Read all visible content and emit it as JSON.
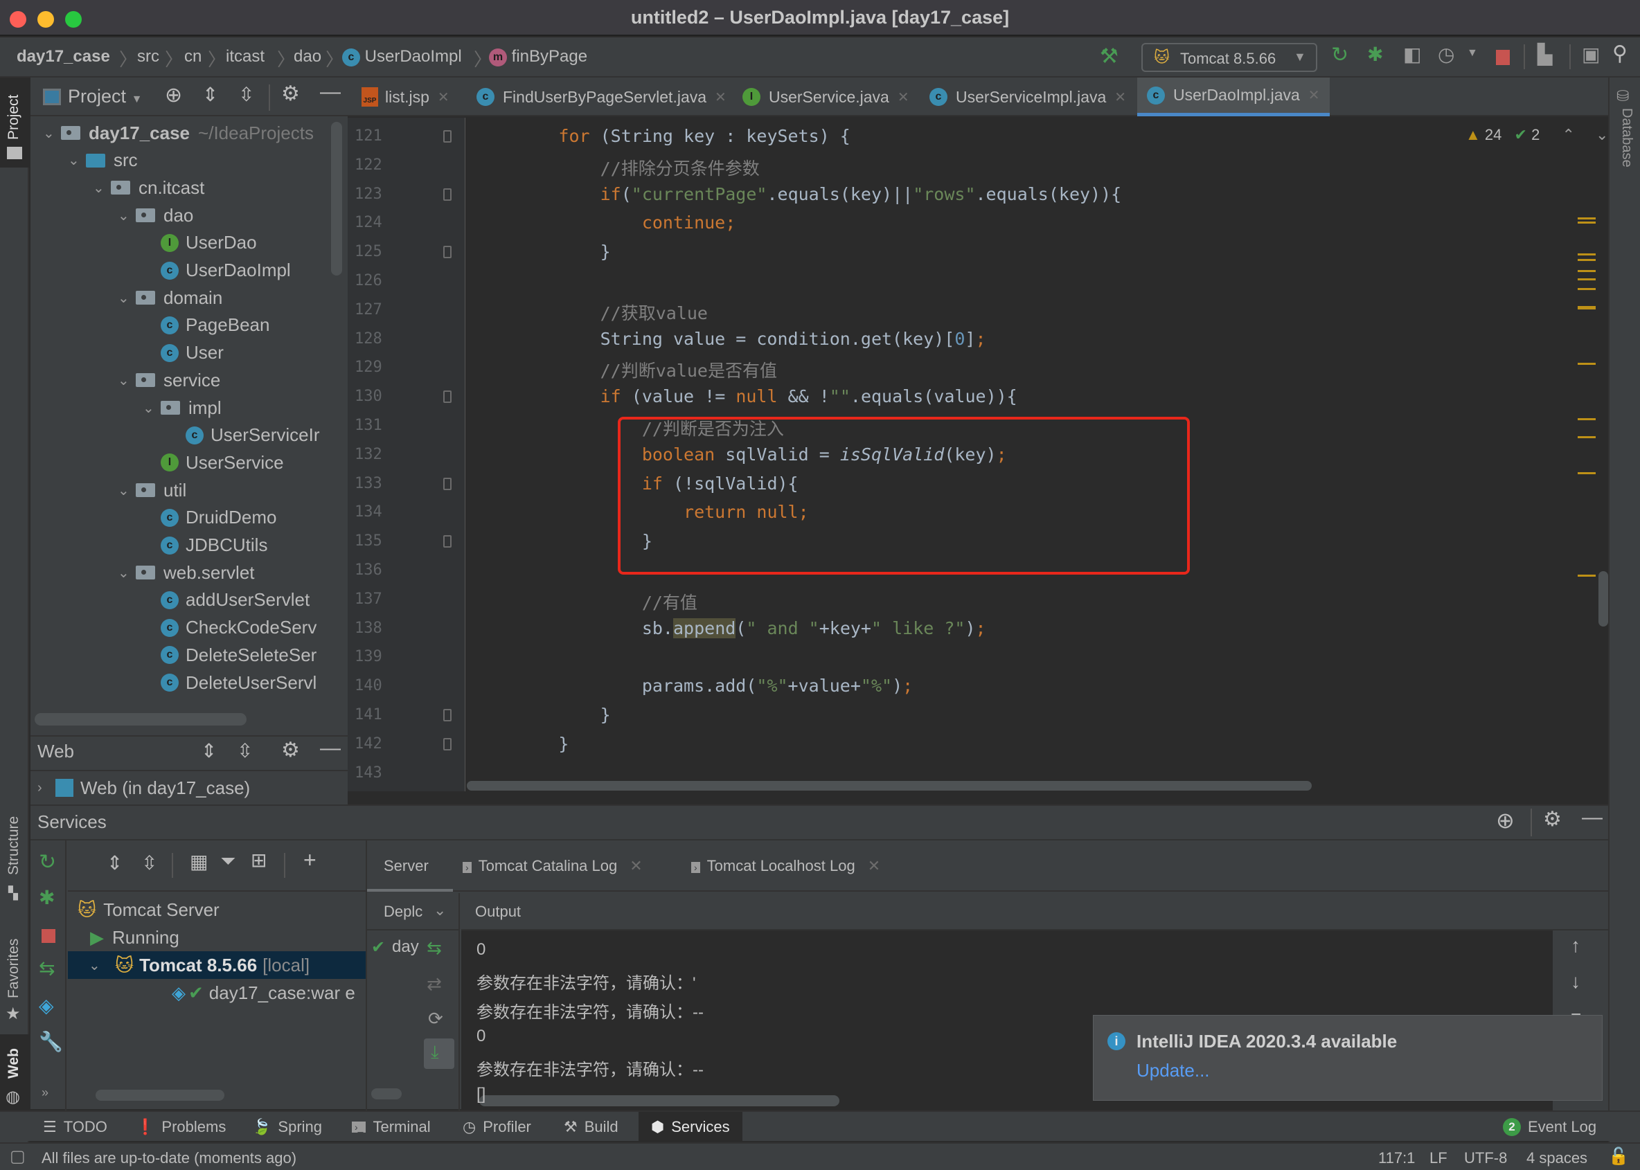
{
  "window": {
    "title": "untitled2 – UserDaoImpl.java [day17_case]"
  },
  "breadcrumb": [
    {
      "label": "day17_case",
      "bold": true
    },
    {
      "label": "src"
    },
    {
      "label": "cn"
    },
    {
      "label": "itcast"
    },
    {
      "label": "dao"
    },
    {
      "label": "UserDaoImpl",
      "icon": "class-icon"
    },
    {
      "label": "finByPage",
      "icon": "method-icon"
    }
  ],
  "toolbar": {
    "run_config": "Tomcat 8.5.66"
  },
  "left_stripe": {
    "project": "Project",
    "structure": "Structure",
    "favorites": "Favorites",
    "web": "Web"
  },
  "right_stripe": {
    "database": "Database"
  },
  "project_panel": {
    "title": "Project",
    "tree": [
      {
        "label": "day17_case",
        "suffix": "~/IdeaProjects",
        "type": "module",
        "depth": 0,
        "expanded": true
      },
      {
        "label": "src",
        "type": "source-folder",
        "depth": 1,
        "expanded": true
      },
      {
        "label": "cn.itcast",
        "type": "package",
        "depth": 2,
        "expanded": true
      },
      {
        "label": "dao",
        "type": "package",
        "depth": 3,
        "expanded": true
      },
      {
        "label": "UserDao",
        "type": "interface",
        "depth": 4
      },
      {
        "label": "UserDaoImpl",
        "type": "class",
        "depth": 4
      },
      {
        "label": "domain",
        "type": "package",
        "depth": 3,
        "expanded": true
      },
      {
        "label": "PageBean",
        "type": "class",
        "depth": 4
      },
      {
        "label": "User",
        "type": "class",
        "depth": 4
      },
      {
        "label": "service",
        "type": "package",
        "depth": 3,
        "expanded": true
      },
      {
        "label": "impl",
        "type": "package",
        "depth": 4,
        "expanded": true
      },
      {
        "label": "UserServiceIr",
        "type": "class",
        "depth": 5
      },
      {
        "label": "UserService",
        "type": "interface",
        "depth": 4
      },
      {
        "label": "util",
        "type": "package",
        "depth": 3,
        "expanded": true
      },
      {
        "label": "DruidDemo",
        "type": "class-runnable",
        "depth": 4
      },
      {
        "label": "JDBCUtils",
        "type": "class",
        "depth": 4
      },
      {
        "label": "web.servlet",
        "type": "package",
        "depth": 3,
        "expanded": true
      },
      {
        "label": "addUserServlet",
        "type": "class",
        "depth": 4
      },
      {
        "label": "CheckCodeServ",
        "type": "class",
        "depth": 4
      },
      {
        "label": "DeleteSeleteSer",
        "type": "class",
        "depth": 4
      },
      {
        "label": "DeleteUserServl",
        "type": "class",
        "depth": 4
      }
    ]
  },
  "web_panel": {
    "title": "Web",
    "item": "Web (in day17_case)"
  },
  "editor": {
    "tabs": [
      {
        "label": "list.jsp",
        "icon": "jsp",
        "active": false
      },
      {
        "label": "FindUserByPageServlet.java",
        "icon": "class",
        "active": false
      },
      {
        "label": "UserService.java",
        "icon": "interface",
        "active": false
      },
      {
        "label": "UserServiceImpl.java",
        "icon": "class",
        "active": false
      },
      {
        "label": "UserDaoImpl.java",
        "icon": "class",
        "active": true
      }
    ],
    "inspections": {
      "warnings": "24",
      "typos": "2"
    },
    "lines": [
      {
        "n": "121",
        "html": "        <span class='kw'>for</span> (String key : keySets) {"
      },
      {
        "n": "122",
        "html": "            <span class='cmt'>//排除分页条件参数</span>"
      },
      {
        "n": "123",
        "html": "            <span class='kw'>if</span>(<span class='str'>\"currentPage\"</span>.equals(key)||<span class='str'>\"rows\"</span>.equals(key)){"
      },
      {
        "n": "124",
        "html": "                <span class='kw'>continue;</span>"
      },
      {
        "n": "125",
        "html": "            }"
      },
      {
        "n": "126",
        "html": ""
      },
      {
        "n": "127",
        "html": "            <span class='cmt'>//获取value</span>"
      },
      {
        "n": "128",
        "html": "            String value = condition.get(key)[<span class='num'>0</span>]<span class='kw'>;</span>"
      },
      {
        "n": "129",
        "html": "            <span class='cmt'>//判断value是否有值</span>"
      },
      {
        "n": "130",
        "html": "            <span class='kw'>if</span> (value != <span class='kw'>null</span> &amp;&amp; !<span class='str'>\"\"</span>.equals(value)){"
      },
      {
        "n": "131",
        "html": "                <span class='cmt'>//判断是否为注入</span>"
      },
      {
        "n": "132",
        "html": "                <span class='kw'>boolean</span> sqlValid = <span class='it'>isSqlValid</span>(key)<span class='kw'>;</span>"
      },
      {
        "n": "133",
        "html": "                <span class='kw'>if</span> (!sqlValid){"
      },
      {
        "n": "134",
        "html": "                    <span class='kw'>return null;</span>"
      },
      {
        "n": "135",
        "html": "                }"
      },
      {
        "n": "136",
        "html": ""
      },
      {
        "n": "137",
        "html": "                <span class='cmt'>//有值</span>"
      },
      {
        "n": "138",
        "html": "                sb.<span class='hl'>append</span>(<span class='str'>\" and \"</span>+key+<span class='str'>\" like ?\"</span>)<span class='kw'>;</span>"
      },
      {
        "n": "139",
        "html": ""
      },
      {
        "n": "140",
        "html": "                params.add(<span class='str'>\"%\"</span>+value+<span class='str'>\"%\"</span>)<span class='kw'>;</span>"
      },
      {
        "n": "141",
        "html": "            }"
      },
      {
        "n": "142",
        "html": "        }"
      },
      {
        "n": "143",
        "html": ""
      }
    ]
  },
  "services": {
    "title": "Services",
    "tree": [
      {
        "label": "Tomcat Server"
      },
      {
        "label": "Running"
      },
      {
        "label": "Tomcat 8.5.66",
        "suffix": "[local]",
        "selected": true
      },
      {
        "label": "day17_case:war e"
      }
    ],
    "tabs": [
      {
        "label": "Server",
        "active": true
      },
      {
        "label": "Tomcat Catalina Log"
      },
      {
        "label": "Tomcat Localhost Log"
      }
    ],
    "deploy_label": "Deplc",
    "deploy_item": "day",
    "output_label": "Output",
    "output_lines": [
      "0",
      "参数存在非法字符，请确认：'",
      "参数存在非法字符，请确认：--",
      "0",
      "参数存在非法字符，请确认：--",
      "[]"
    ]
  },
  "notification": {
    "title": "IntelliJ IDEA 2020.3.4 available",
    "action": "Update..."
  },
  "bottom_tabs": [
    {
      "label": "TODO",
      "icon": "list-icon"
    },
    {
      "label": "Problems",
      "icon": "problems-icon"
    },
    {
      "label": "Spring",
      "icon": "spring-icon"
    },
    {
      "label": "Terminal",
      "icon": "terminal-icon"
    },
    {
      "label": "Profiler",
      "icon": "profiler-icon"
    },
    {
      "label": "Build",
      "icon": "hammer-icon"
    },
    {
      "label": "Services",
      "icon": "services-icon",
      "active": true
    }
  ],
  "event_log": {
    "count": "2",
    "label": "Event Log"
  },
  "status_bar": {
    "message": "All files are up-to-date (moments ago)",
    "position": "117:1",
    "line_sep": "LF",
    "encoding": "UTF-8",
    "indent": "4 spaces"
  },
  "colors": {
    "accent": "#4a88c7",
    "highlight_box": "#e8271b",
    "keyword": "#cc7832",
    "string": "#6a8759",
    "comment": "#808080",
    "number": "#6897bb",
    "warning": "#be9117",
    "link": "#589df6"
  }
}
